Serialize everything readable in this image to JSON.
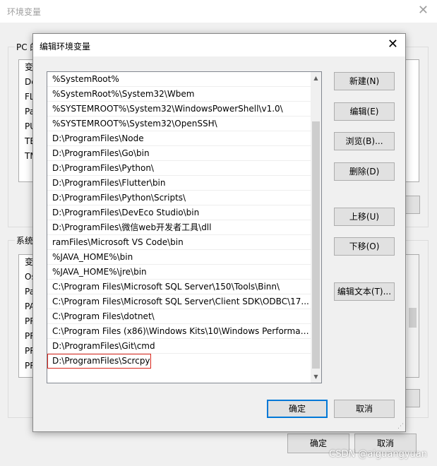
{
  "background_window": {
    "title": "环境变量",
    "user_group_label": "PC 的",
    "user_list_items": [
      "变",
      "De",
      "FL",
      "Pa",
      "PU",
      "TE",
      "TM"
    ],
    "system_group_label": "系统",
    "system_list_items": [
      "变",
      "Os",
      "Pa",
      "PA",
      "PR",
      "PR",
      "PR",
      "PR"
    ],
    "ok_label": "确定",
    "cancel_label": "取消"
  },
  "dialog": {
    "title": "编辑环境变量",
    "paths": [
      "%SystemRoot%",
      "%SystemRoot%\\System32\\Wbem",
      "%SYSTEMROOT%\\System32\\WindowsPowerShell\\v1.0\\",
      "%SYSTEMROOT%\\System32\\OpenSSH\\",
      "D:\\ProgramFiles\\Node",
      "D:\\ProgramFiles\\Go\\bin",
      "D:\\ProgramFiles\\Python\\",
      "D:\\ProgramFiles\\Flutter\\bin",
      "D:\\ProgramFiles\\Python\\Scripts\\",
      "D:\\ProgramFiles\\DevEco Studio\\bin",
      "D:\\ProgramFiles\\微信web开发者工具\\dll",
      "ramFiles\\Microsoft VS Code\\bin",
      "%JAVA_HOME%\\bin",
      "%JAVA_HOME%\\jre\\bin",
      "C:\\Program Files\\Microsoft SQL Server\\150\\Tools\\Binn\\",
      "C:\\Program Files\\Microsoft SQL Server\\Client SDK\\ODBC\\17...",
      "C:\\Program Files\\dotnet\\",
      "C:\\Program Files (x86)\\Windows Kits\\10\\Windows Performan...",
      "D:\\ProgramFiles\\Git\\cmd",
      "D:\\ProgramFiles\\Scrcpy"
    ],
    "selected_index": 19,
    "buttons": {
      "new": "新建(N)",
      "edit": "编辑(E)",
      "browse": "浏览(B)...",
      "delete": "删除(D)",
      "move_up": "上移(U)",
      "move_down": "下移(O)",
      "edit_text": "编辑文本(T)...",
      "ok": "确定",
      "cancel": "取消"
    },
    "colors": {
      "accent": "#0078d7",
      "selection_outline": "#d9261c"
    }
  },
  "watermark": "CSDN @aiguangyuan"
}
